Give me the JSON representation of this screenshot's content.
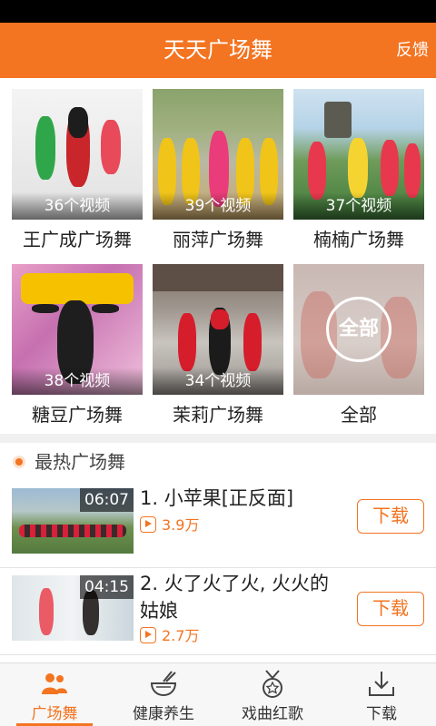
{
  "header": {
    "title": "天天广场舞",
    "feedback_label": "反馈"
  },
  "categories": [
    {
      "name": "王广成广场舞",
      "count": "36个视频",
      "thumb": "studio"
    },
    {
      "name": "丽萍广场舞",
      "count": "39个视频",
      "thumb": "garden"
    },
    {
      "name": "楠楠广场舞",
      "count": "37个视频",
      "thumb": "park"
    },
    {
      "name": "糖豆广场舞",
      "count": "38个视频",
      "thumb": "stage"
    },
    {
      "name": "茉莉广场舞",
      "count": "34个视频",
      "thumb": "street"
    },
    {
      "name": "全部",
      "badge": "全部",
      "thumb": "all"
    }
  ],
  "hot_section": {
    "title": "最热广场舞",
    "videos": [
      {
        "title": "1. 小苹果[正反面]",
        "duration": "06:07",
        "plays": "3.9万",
        "download_label": "下载"
      },
      {
        "title": "2. 火了火了火, 火火的姑娘",
        "duration": "04:15",
        "plays": "2.7万",
        "download_label": "下载"
      }
    ]
  },
  "tabs": [
    {
      "label": "广场舞",
      "icon": "people-icon",
      "active": true
    },
    {
      "label": "健康养生",
      "icon": "bowl-icon",
      "active": false
    },
    {
      "label": "戏曲红歌",
      "icon": "medal-icon",
      "active": false
    },
    {
      "label": "下载",
      "icon": "download-icon",
      "active": false
    }
  ],
  "colors": {
    "accent": "#f37421",
    "status_bar": "#000000",
    "section_background": "#f0f0f0"
  }
}
